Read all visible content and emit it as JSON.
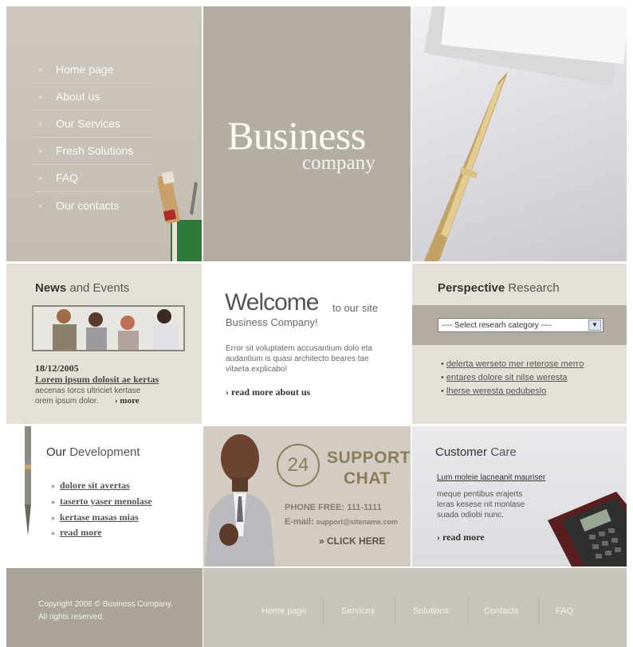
{
  "nav": {
    "items": [
      {
        "label": "Home page"
      },
      {
        "label": "About us"
      },
      {
        "label": "Our Services"
      },
      {
        "label": "Fresh Solutions"
      },
      {
        "label": "FAQ"
      },
      {
        "label": "Our contacts"
      }
    ],
    "bullet": "»"
  },
  "brand": {
    "title": "Business",
    "subtitle": "company"
  },
  "news": {
    "title_bold": "News",
    "title_rest": "and Events",
    "date": "18/12/2005",
    "headline": "Lorem ipsum dolosit ae kertas",
    "line1": "aecenas torcs ultriciet kertase",
    "line2": "orem ipsum dolor.",
    "more": "› more"
  },
  "welcome": {
    "title": "Welcome",
    "title_tail": "to our site",
    "subtitle": "Business Company!",
    "body": "Error sit voluptatem accusantium dolo eta audantium is quasi architecto beares tae vitaeta explicabo!",
    "more": "› read more about us"
  },
  "research": {
    "title_bold": "Perspective",
    "title_rest": "Research",
    "select_value": "---- Select researh category ----",
    "items": [
      {
        "label": "delerta werseto mer reterose merro"
      },
      {
        "label": "entares dolore sit nilse weresta"
      },
      {
        "label": "lherse weresta pedubeslo"
      }
    ]
  },
  "development": {
    "title_bold": "Our",
    "title_rest": "Development",
    "items": [
      {
        "label": "dolore sit avertas"
      },
      {
        "label": "taserto yaser menolase"
      },
      {
        "label": "kertase masas mias"
      },
      {
        "label": "read more"
      }
    ],
    "arrow": "»"
  },
  "support": {
    "badge": "24",
    "line1": "SUPPORT",
    "line2": "CHAT",
    "phone": "PHONE FREE: 111-1111",
    "email_label": "E-mail:",
    "email": "support@sitename.com",
    "cta": "» CLICK HERE"
  },
  "care": {
    "title_bold": "Customer",
    "title_rest": "Care",
    "link": "Lum moleie lacneanit mauriser",
    "body1": "meque pentibus erajerts",
    "body2": "leras kesese nit monlase",
    "body3": "suada odiobi nunc.",
    "more": "› read more"
  },
  "footer": {
    "copyright1": "Copyright 2006 © Business Company.",
    "copyright2": "All rights reserved.",
    "links": [
      {
        "label": "Home page"
      },
      {
        "label": "Services"
      },
      {
        "label": "Solutions"
      },
      {
        "label": "Contacts"
      },
      {
        "label": "FAQ"
      }
    ]
  },
  "colors": {
    "beige": "#e4e0d8",
    "taupe": "#b3ada3",
    "accent_brown": "#8b7d5a"
  }
}
